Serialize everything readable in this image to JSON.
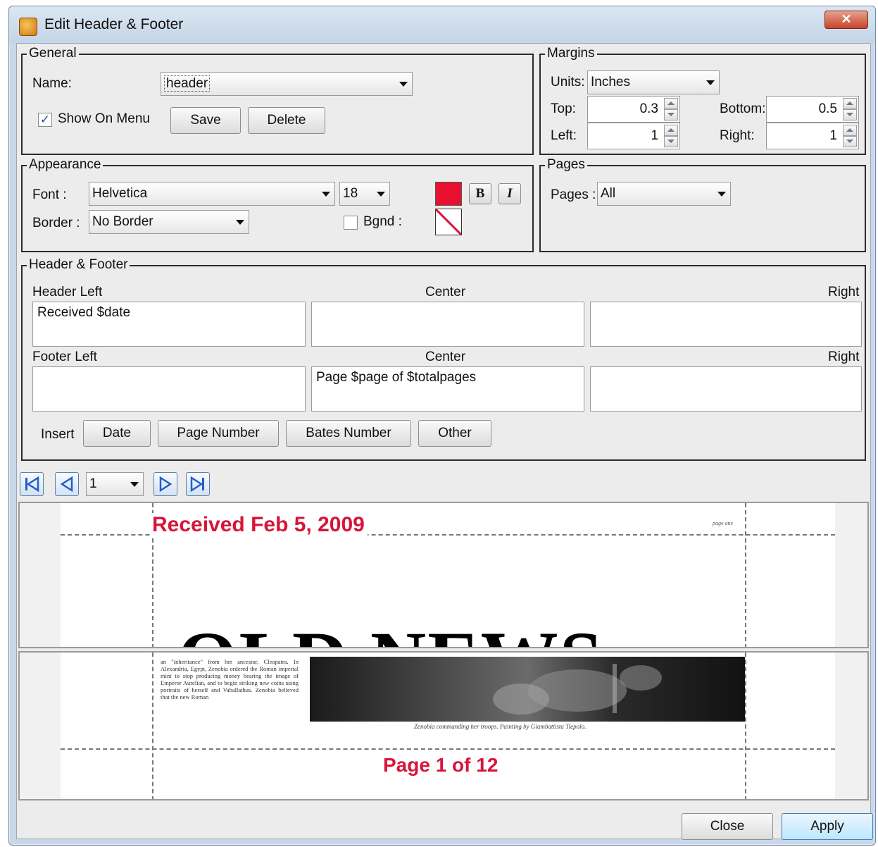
{
  "window": {
    "title": "Edit Header & Footer",
    "close_glyph": "✕"
  },
  "general": {
    "legend": "General",
    "name_label": "Name:",
    "name_value": "header",
    "show_on_menu_label": "Show On Menu",
    "show_on_menu_checked": true,
    "save_label": "Save",
    "delete_label": "Delete"
  },
  "margins": {
    "legend": "Margins",
    "units_label": "Units:",
    "units_value": "Inches",
    "top_label": "Top:",
    "top_value": "0.3",
    "bottom_label": "Bottom:",
    "bottom_value": "0.5",
    "left_label": "Left:",
    "left_value": "1",
    "right_label": "Right:",
    "right_value": "1"
  },
  "appearance": {
    "legend": "Appearance",
    "font_label": "Font :",
    "font_value": "Helvetica",
    "size_value": "18",
    "color": "#e8102e",
    "bold_label": "B",
    "italic_label": "I",
    "border_label": "Border :",
    "border_value": "No Border",
    "bgnd_label": "Bgnd :",
    "bgnd_checked": false
  },
  "pages": {
    "legend": "Pages",
    "pages_label": "Pages :",
    "pages_value": "All"
  },
  "header_footer": {
    "legend": "Header & Footer",
    "header_left_label": "Header Left",
    "header_center_label": "Center",
    "header_right_label": "Right",
    "header_left_value": "Received $date",
    "header_center_value": "",
    "header_right_value": "",
    "footer_left_label": "Footer Left",
    "footer_center_label": "Center",
    "footer_right_label": "Right",
    "footer_left_value": "",
    "footer_center_value": "Page $page of $totalpages",
    "footer_right_value": "",
    "insert_label": "Insert",
    "insert_buttons": {
      "date": "Date",
      "page_number": "Page Number",
      "bates_number": "Bates Number",
      "other": "Other"
    }
  },
  "navigation": {
    "page_value": "1"
  },
  "preview": {
    "header_text": "Received Feb 5, 2009",
    "header_right_small": "page one",
    "masthead": "OLD NEWS",
    "column_text": "an \"inheritance\" from her ancestor, Cleopatra. In Alexandria, Egypt, Zenobia ordered the Roman imperial mint to stop producing money bearing the image of Emperor Aurelian, and to begin striking new coins using portraits of herself and Vaballathus. Zenobia believed that the new Roman",
    "caption": "Zenobia commanding her troops. Painting by Giambattista Tiepolo.",
    "footer_text": "Page 1 of 12",
    "accent_color": "#d6153a"
  },
  "buttons": {
    "close_label": "Close",
    "apply_label": "Apply"
  }
}
